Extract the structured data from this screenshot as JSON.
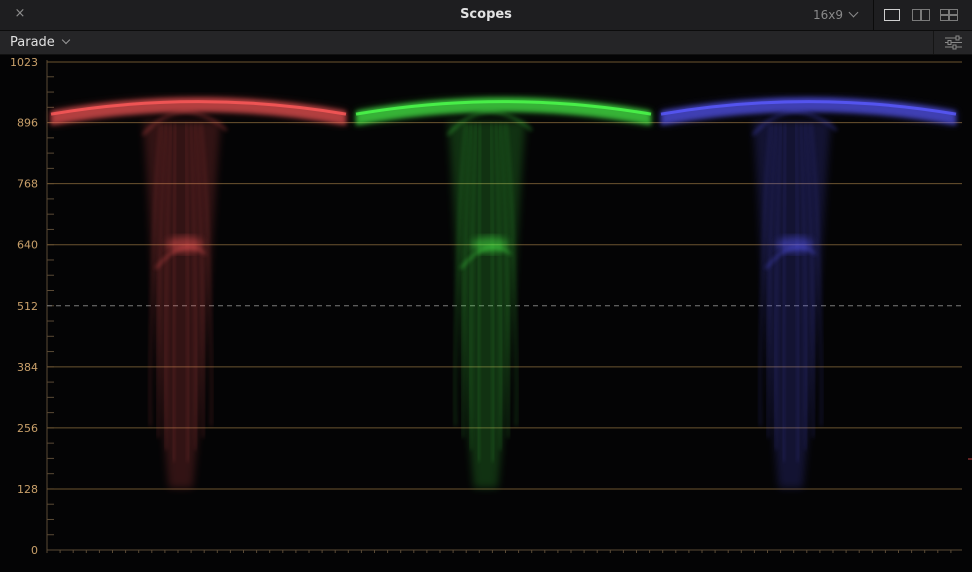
{
  "window": {
    "title": "Scopes",
    "close_icon": "×",
    "aspect_ratio": "16x9"
  },
  "toolbar": {
    "scope_mode": "Parade"
  },
  "scope": {
    "y_axis_labels": [
      "1023",
      "896",
      "768",
      "640",
      "512",
      "384",
      "256",
      "128",
      "0"
    ],
    "y_axis_values": [
      1023,
      896,
      768,
      640,
      512,
      384,
      256,
      128,
      0
    ],
    "y_range": [
      0,
      1023
    ],
    "channels": [
      {
        "id": "red",
        "color": "#ff5a5a"
      },
      {
        "id": "green",
        "color": "#4dff4d"
      },
      {
        "id": "blue",
        "color": "#5a5aff"
      }
    ],
    "gridline_color": "#6b5330",
    "label_color": "#c9a06a",
    "dashed_level": 512
  }
}
